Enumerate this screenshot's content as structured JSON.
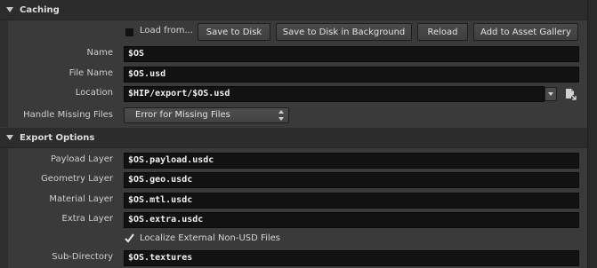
{
  "caching": {
    "header": "Caching",
    "load_from_label": "Load from...",
    "load_from_checked": false,
    "buttons": {
      "save_to_disk": "Save to Disk",
      "save_background": "Save to Disk in Background",
      "reload": "Reload",
      "add_gallery": "Add to Asset Gallery"
    },
    "name": {
      "label": "Name",
      "value": "$OS"
    },
    "file_name": {
      "label": "File Name",
      "value": "$OS.usd"
    },
    "location": {
      "label": "Location",
      "value": "$HIP/export/$OS.usd"
    },
    "handle_missing": {
      "label": "Handle Missing Files",
      "value": "Error for Missing Files"
    }
  },
  "export_options": {
    "header": "Export Options",
    "payload": {
      "label": "Payload Layer",
      "value": "$OS.payload.usdc"
    },
    "geometry": {
      "label": "Geometry Layer",
      "value": "$OS.geo.usdc"
    },
    "material": {
      "label": "Material Layer",
      "value": "$OS.mtl.usdc"
    },
    "extra": {
      "label": "Extra Layer",
      "value": "$OS.extra.usdc"
    },
    "localize_label": "Localize External Non-USD Files",
    "localize_checked": true,
    "subdir": {
      "label": "Sub-Directory",
      "value": "$OS.textures"
    }
  },
  "colors": {
    "background": "#3a3a3a",
    "header": "#2c2c2c",
    "field": "#121212"
  }
}
